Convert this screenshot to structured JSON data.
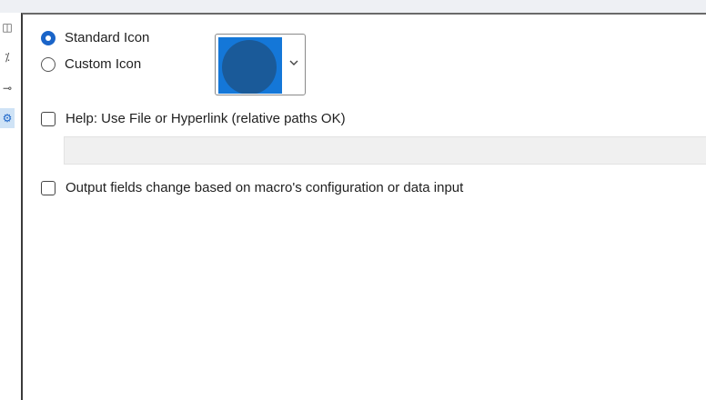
{
  "rail": {
    "items": [
      {
        "icon": "layout-icon",
        "glyph": "◫"
      },
      {
        "icon": "magic-wand-icon",
        "glyph": "⁒"
      },
      {
        "icon": "connection-icon",
        "glyph": "⊸"
      },
      {
        "icon": "gear-icon",
        "glyph": "⚙"
      }
    ]
  },
  "icon_options": {
    "standard_label": "Standard Icon",
    "custom_label": "Custom Icon",
    "selected": "standard"
  },
  "help": {
    "label": "Help: Use File or Hyperlink (relative paths OK)",
    "value": "",
    "checked": false
  },
  "output_fields": {
    "label": "Output fields change based on macro's configuration or data input",
    "checked": false
  },
  "colors": {
    "accent": "#1a64c8",
    "swatch_bg": "#1477d8",
    "swatch_circle": "#1a5a99"
  }
}
